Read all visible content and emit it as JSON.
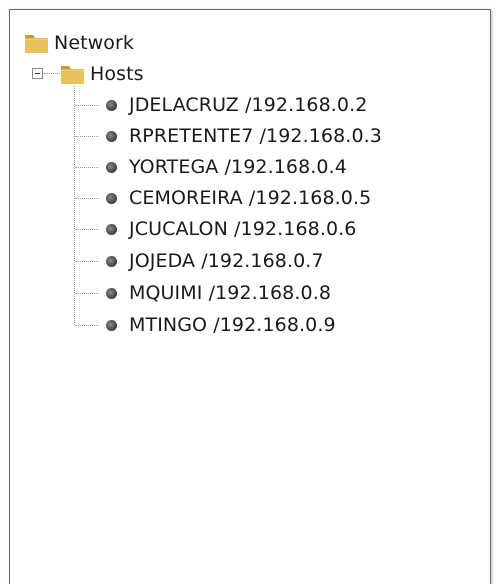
{
  "tree": {
    "root": {
      "label": "Network",
      "icon": "folder-icon"
    },
    "group": {
      "label": "Hosts",
      "icon": "folder-icon",
      "expanded": true
    },
    "hosts": [
      {
        "label": "JDELACRUZ /192.168.0.2"
      },
      {
        "label": "RPRETENTE7 /192.168.0.3"
      },
      {
        "label": "YORTEGA /192.168.0.4"
      },
      {
        "label": "CEMOREIRA /192.168.0.5"
      },
      {
        "label": "JCUCALON /192.168.0.6"
      },
      {
        "label": "JOJEDA /192.168.0.7"
      },
      {
        "label": "MQUIMI /192.168.0.8"
      },
      {
        "label": "MTINGO /192.168.0.9"
      }
    ]
  },
  "colors": {
    "folder_body": "#e8c15a",
    "folder_dark": "#c99a2e",
    "border": "#6b6b6b",
    "host_dot": "#4a4a4a"
  }
}
